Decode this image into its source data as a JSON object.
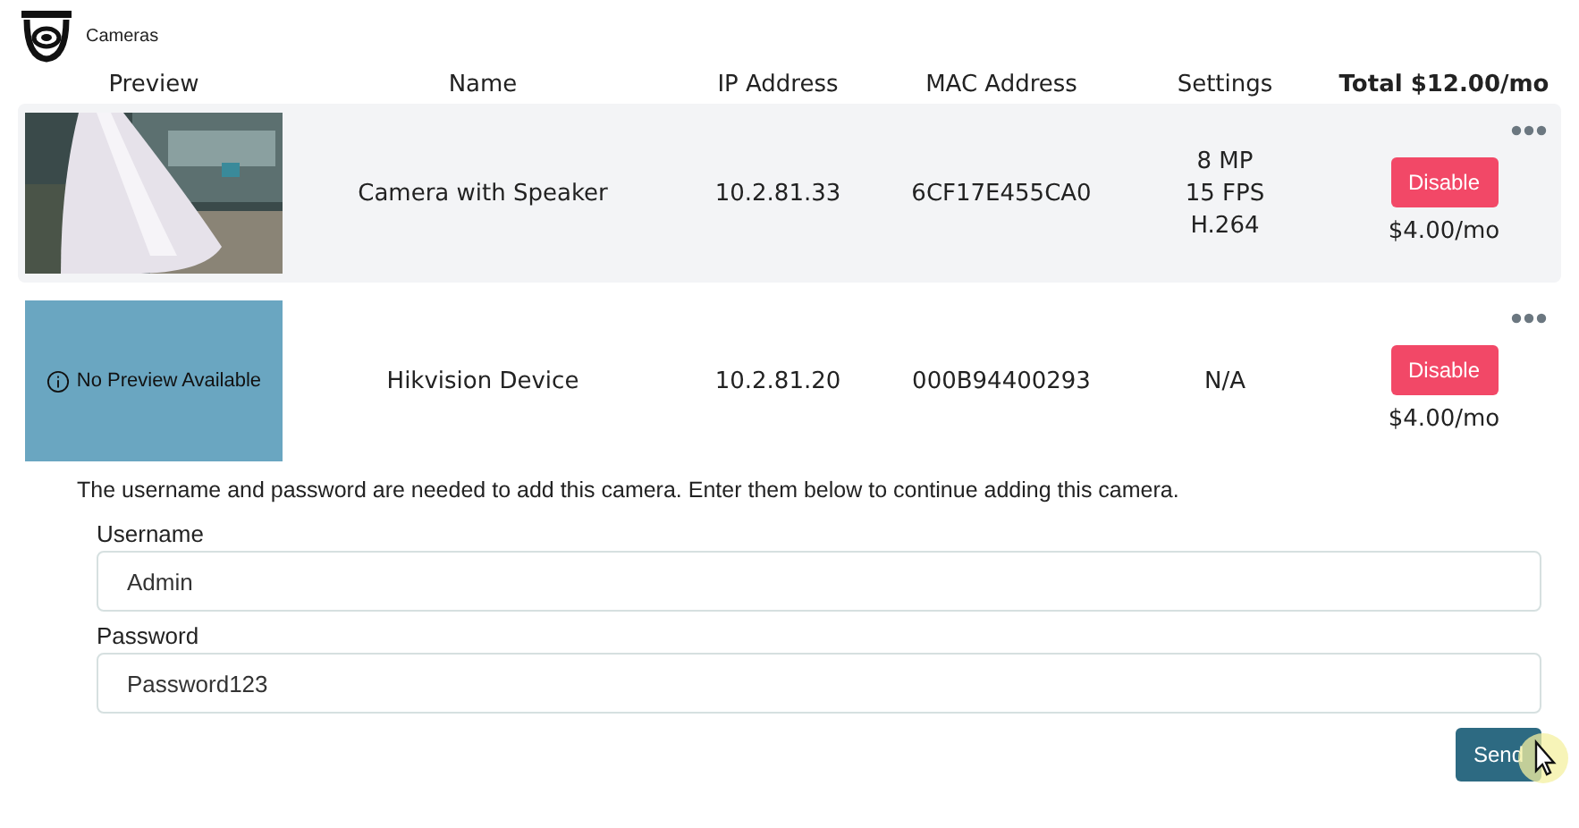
{
  "header": {
    "title": "Cameras"
  },
  "columns": [
    "Preview",
    "Name",
    "IP Address",
    "MAC Address",
    "Settings",
    "Total $12.00/mo"
  ],
  "cameras": [
    {
      "name": "Camera with Speaker",
      "ip": "10.2.81.33",
      "mac": "6CF17E455CA0",
      "settings": [
        "8 MP",
        "15 FPS",
        "H.264"
      ],
      "action": "Disable",
      "price": "$4.00/mo",
      "selected": true
    },
    {
      "preview": {
        "kind": "none",
        "text": "No Preview Available"
      },
      "name": "Hikvision Device",
      "ip": "10.2.81.20",
      "mac": "000B94400293",
      "settings": [
        "N/A"
      ],
      "action": "Disable",
      "price": "$4.00/mo",
      "selected": false
    }
  ],
  "credentials": {
    "message": "The username and password are needed to add this camera. Enter them below to continue adding this camera.",
    "fields": [
      {
        "label": "Username",
        "value": "Admin"
      },
      {
        "label": "Password",
        "value": "Password123"
      }
    ],
    "button": "Send"
  }
}
